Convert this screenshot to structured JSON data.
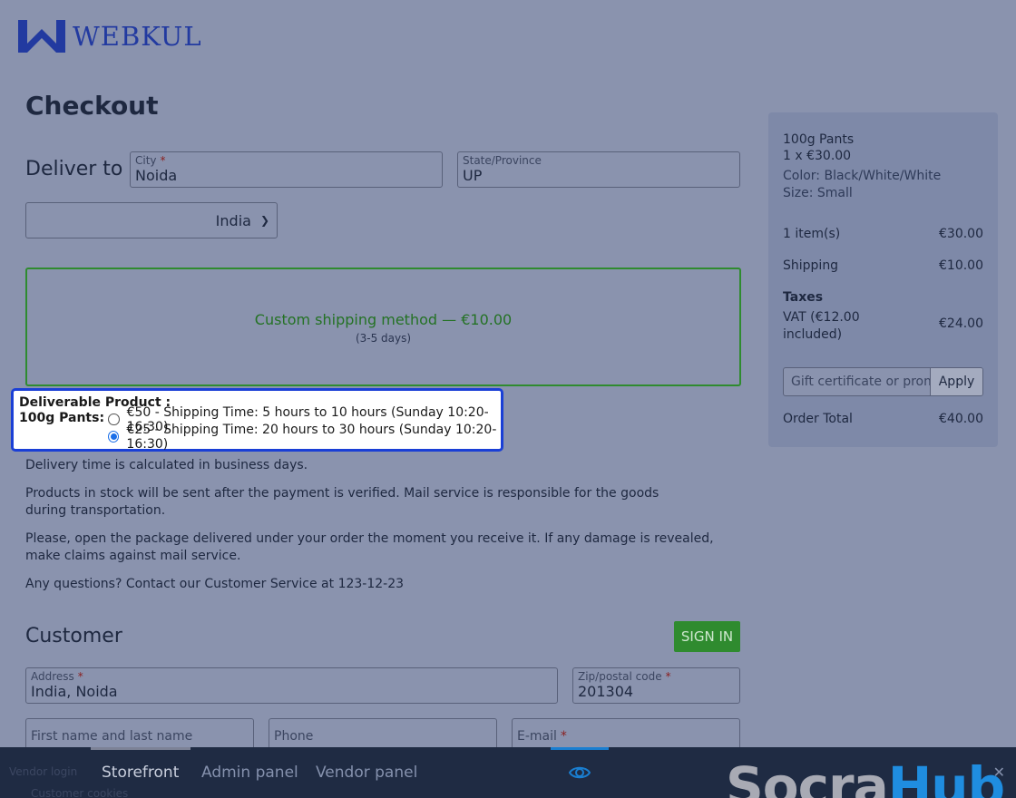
{
  "brand": {
    "name": "WEBKUL",
    "color": "#223aa0"
  },
  "page": {
    "title": "Checkout"
  },
  "delivery": {
    "label": "Deliver to",
    "city": {
      "label": "City",
      "value": "Noida"
    },
    "state": {
      "label": "State/Province",
      "value": "UP"
    },
    "country": {
      "value": "India"
    }
  },
  "shipping_method": {
    "name": "Custom shipping method — €10.00",
    "days": "(3-5 days)"
  },
  "deliverable": {
    "title": "Deliverable Product :",
    "product": "100g Pants:",
    "options": [
      {
        "label": "€50 - Shipping Time: 5 hours to 10 hours (Sunday 10:20-16:30)",
        "selected": false
      },
      {
        "label": "€25 - Shipping Time: 20 hours to 30 hours (Sunday 10:20-16:30)",
        "selected": true
      }
    ]
  },
  "info": [
    "Delivery time is calculated in business days.",
    "Products in stock will be sent after the payment is verified. Mail service is responsible for the goods during transportation.",
    "Please, open the package delivered under your order the moment you receive it. If any damage is revealed, make claims against mail service.",
    "Any questions? Contact our Customer Service at 123-12-23"
  ],
  "customer": {
    "title": "Customer",
    "signin": "SIGN IN",
    "address": {
      "label": "Address",
      "value": "India, Noida"
    },
    "zip": {
      "label": "Zip/postal code",
      "value": "201304"
    },
    "name_placeholder": "First name and last name",
    "phone_placeholder": "Phone",
    "email_label": "E-mail",
    "cookies_text": "Customer cookies"
  },
  "summary": {
    "product_name": "100g Pants",
    "product_qty": "1 x €30.00",
    "product_color": "Color: Black/White/White",
    "product_size": "Size: Small",
    "items_label": "1 item(s)",
    "items_value": "€30.00",
    "shipping_label": "Shipping",
    "shipping_value": "€10.00",
    "taxes_label": "Taxes",
    "vat_label_1": "VAT (€12.00",
    "vat_label_2": "included)",
    "vat_value": "€24.00",
    "gift_placeholder": "Gift certificate or promo code",
    "apply_label": "Apply",
    "total_label": "Order Total",
    "total_value": "€40.00"
  },
  "bottom_bar": {
    "tabs": [
      "Storefront",
      "Admin panel",
      "Vendor panel"
    ],
    "brand_part1": "Socra",
    "brand_part2": "Hub",
    "ghost_text": "Vendor login"
  },
  "colors": {
    "accent_green": "#2f8b2f",
    "popup_border": "#1a3fd6",
    "brand_blue": "#1f8de0"
  }
}
